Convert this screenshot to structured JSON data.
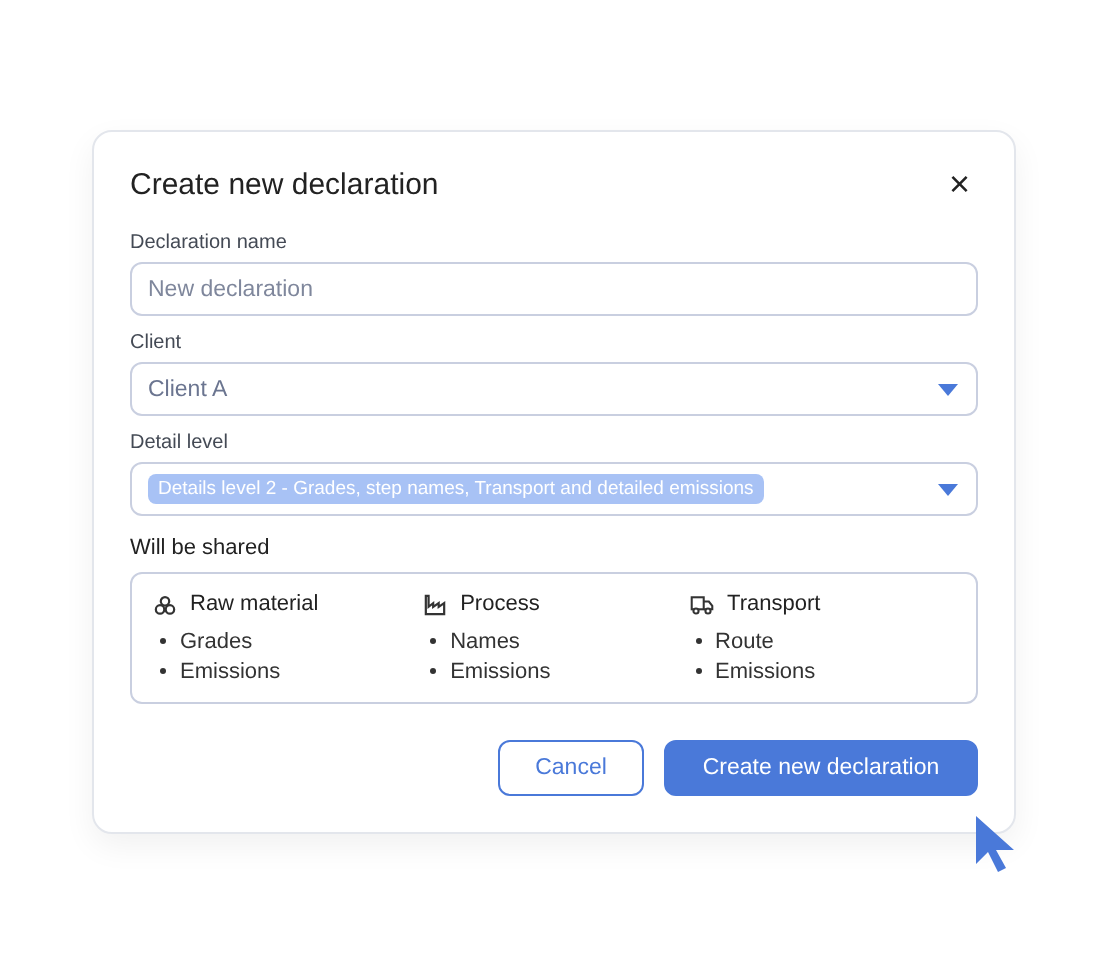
{
  "dialog": {
    "title": "Create new declaration",
    "close": "×"
  },
  "fields": [
    {
      "kind": "text",
      "label": "Declaration name",
      "placeholder": "New declaration"
    },
    {
      "kind": "select",
      "label": "Client",
      "value": "Client A"
    },
    {
      "kind": "chip-select",
      "label": "Detail level",
      "value": "Details level 2 - Grades, step names, Transport and detailed emissions"
    }
  ],
  "shared": {
    "title": "Will be shared",
    "groups": [
      {
        "kind": "material",
        "title": "Raw material",
        "items": [
          "Grades",
          "Emissions"
        ]
      },
      {
        "kind": "process",
        "title": "Process",
        "items": [
          "Names",
          "Emissions"
        ]
      },
      {
        "kind": "transport",
        "title": "Transport",
        "items": [
          "Route",
          "Emissions"
        ]
      }
    ]
  },
  "buttons": [
    {
      "kind": "secondary",
      "label": "Cancel"
    },
    {
      "kind": "primary",
      "label": "Create new declaration"
    }
  ]
}
